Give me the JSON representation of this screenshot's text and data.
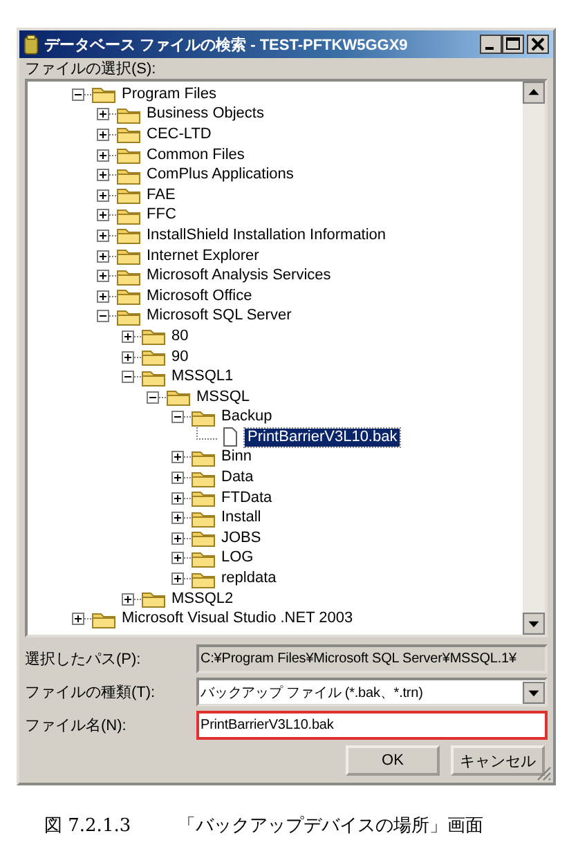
{
  "window": {
    "title": "データベース ファイルの検索 - TEST-PFTKW5GGX9"
  },
  "tree": {
    "label": "ファイルの選択(S):",
    "items": [
      {
        "label": "Program Files",
        "kind": "folder",
        "expanded": true,
        "selected": false,
        "children": [
          {
            "label": "Business Objects",
            "kind": "folder",
            "expanded": false,
            "selected": false
          },
          {
            "label": "CEC-LTD",
            "kind": "folder",
            "expanded": false,
            "selected": false
          },
          {
            "label": "Common Files",
            "kind": "folder",
            "expanded": false,
            "selected": false
          },
          {
            "label": "ComPlus Applications",
            "kind": "folder",
            "expanded": false,
            "selected": false
          },
          {
            "label": "FAE",
            "kind": "folder",
            "expanded": false,
            "selected": false
          },
          {
            "label": "FFC",
            "kind": "folder",
            "expanded": false,
            "selected": false
          },
          {
            "label": "InstallShield Installation Information",
            "kind": "folder",
            "expanded": false,
            "selected": false
          },
          {
            "label": "Internet Explorer",
            "kind": "folder",
            "expanded": false,
            "selected": false
          },
          {
            "label": "Microsoft Analysis Services",
            "kind": "folder",
            "expanded": false,
            "selected": false
          },
          {
            "label": "Microsoft Office",
            "kind": "folder",
            "expanded": false,
            "selected": false
          },
          {
            "label": "Microsoft SQL Server",
            "kind": "folder",
            "expanded": true,
            "selected": false,
            "children": [
              {
                "label": "80",
                "kind": "folder",
                "expanded": false,
                "selected": false
              },
              {
                "label": "90",
                "kind": "folder",
                "expanded": false,
                "selected": false
              },
              {
                "label": "MSSQL1",
                "kind": "folder",
                "expanded": true,
                "selected": false,
                "children": [
                  {
                    "label": "MSSQL",
                    "kind": "folder",
                    "expanded": true,
                    "selected": false,
                    "children": [
                      {
                        "label": "Backup",
                        "kind": "folder",
                        "expanded": true,
                        "selected": false,
                        "children": [
                          {
                            "label": "PrintBarrierV3L10.bak",
                            "kind": "file",
                            "selected": true
                          }
                        ]
                      },
                      {
                        "label": "Binn",
                        "kind": "folder",
                        "expanded": false,
                        "selected": false
                      },
                      {
                        "label": "Data",
                        "kind": "folder",
                        "expanded": false,
                        "selected": false
                      },
                      {
                        "label": "FTData",
                        "kind": "folder",
                        "expanded": false,
                        "selected": false
                      },
                      {
                        "label": "Install",
                        "kind": "folder",
                        "expanded": false,
                        "selected": false
                      },
                      {
                        "label": "JOBS",
                        "kind": "folder",
                        "expanded": false,
                        "selected": false
                      },
                      {
                        "label": "LOG",
                        "kind": "folder",
                        "expanded": false,
                        "selected": false
                      },
                      {
                        "label": "repldata",
                        "kind": "folder",
                        "expanded": false,
                        "selected": false
                      }
                    ]
                  }
                ]
              },
              {
                "label": "MSSQL2",
                "kind": "folder",
                "expanded": false,
                "selected": false
              }
            ]
          }
        ]
      },
      {
        "label": "Microsoft Visual Studio .NET 2003",
        "kind": "folder",
        "expanded": false,
        "selected": false
      }
    ]
  },
  "fields": [
    {
      "label": "選択したパス(P):",
      "kind": "text",
      "value": "C:¥Program Files¥Microsoft SQL Server¥MSSQL.1¥",
      "disabled": true,
      "highlighted": false
    },
    {
      "label": "ファイルの種類(T):",
      "kind": "dropdown",
      "value": "バックアップ ファイル (*.bak、*.trn)",
      "disabled": false,
      "highlighted": false
    },
    {
      "label": "ファイル名(N):",
      "kind": "text",
      "value": "PrintBarrierV3L10.bak",
      "disabled": false,
      "highlighted": true
    }
  ],
  "buttons": [
    "OK",
    "キャンセル"
  ],
  "caption": {
    "number": "図 7.2.1.3",
    "title": "「バックアップデバイスの場所」画面"
  }
}
